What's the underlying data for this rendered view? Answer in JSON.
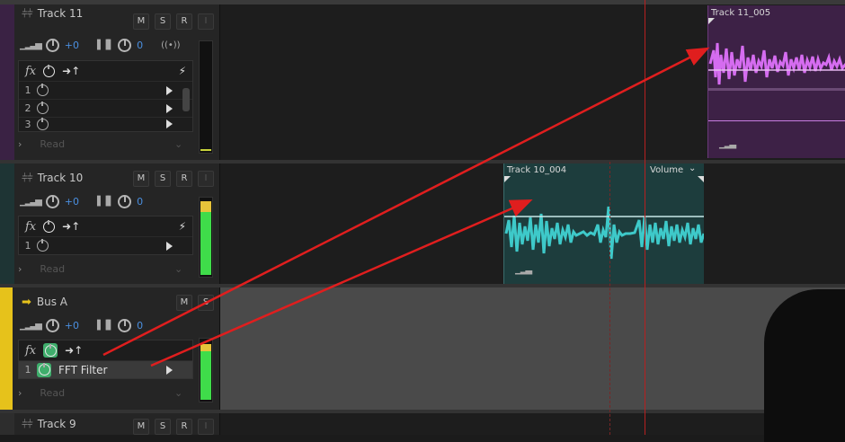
{
  "tracks": [
    {
      "name": "Track 11",
      "color": "#5a2a6e",
      "volume": "+0",
      "pan": "0",
      "buttons": [
        "M",
        "S",
        "R",
        "I"
      ],
      "fx_slots": [
        "1",
        "2",
        "3"
      ],
      "read": "Read"
    },
    {
      "name": "Track 10",
      "color": "#1f4a4a",
      "volume": "+0",
      "pan": "0",
      "buttons": [
        "M",
        "S",
        "R",
        "I"
      ],
      "fx_slots": [
        "1"
      ],
      "read": "Read"
    },
    {
      "name": "Bus A",
      "color": "#e6c21b",
      "volume": "+0",
      "pan": "0",
      "buttons": [
        "M",
        "S"
      ],
      "fx_slots": [
        {
          "num": "1",
          "effect": "FFT Filter"
        }
      ],
      "read": "Read"
    },
    {
      "name": "Track 9",
      "buttons": [
        "M",
        "S",
        "R",
        "I"
      ]
    }
  ],
  "clips": {
    "track11": {
      "title": "Track 11_005",
      "color": "#d56cf0"
    },
    "track10": {
      "title": "Track 10_004",
      "envelope_label": "Volume",
      "color": "#3ec9c9"
    }
  },
  "colors": {
    "playhead": "#b62020",
    "annotation_arrow": "#e01e1e"
  },
  "icons": [
    "waveform-icon",
    "volume-knob-icon",
    "pan-knob-icon",
    "fx-icon",
    "power-icon",
    "output-icon",
    "lightning-icon",
    "play-icon",
    "chevron-right-icon"
  ]
}
